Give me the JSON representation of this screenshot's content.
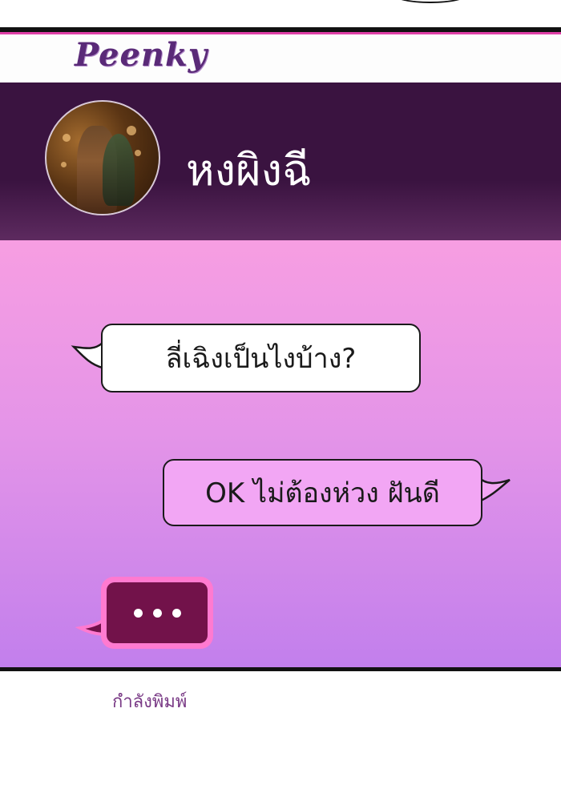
{
  "app": {
    "logo": "Peenky"
  },
  "header": {
    "contact_name": "หงผิงฉี"
  },
  "messages": [
    {
      "direction": "incoming",
      "text": "ลี่เฉิงเป็นไงบ้าง?"
    },
    {
      "direction": "outgoing",
      "text": "OK ไม่ต้องห่วง ฝันดี"
    }
  ],
  "typing_indicator": {
    "dots": "..."
  },
  "status": {
    "text": "กำลังพิมพ์"
  },
  "colors": {
    "header_bg": "#3a1340",
    "chat_top": "#f79ee2",
    "chat_bottom": "#c27fec",
    "outgoing_bubble": "#f2a6f4",
    "typing_outer": "#ff7ad0",
    "typing_inner": "#72124a",
    "logo": "#5a2a78"
  }
}
